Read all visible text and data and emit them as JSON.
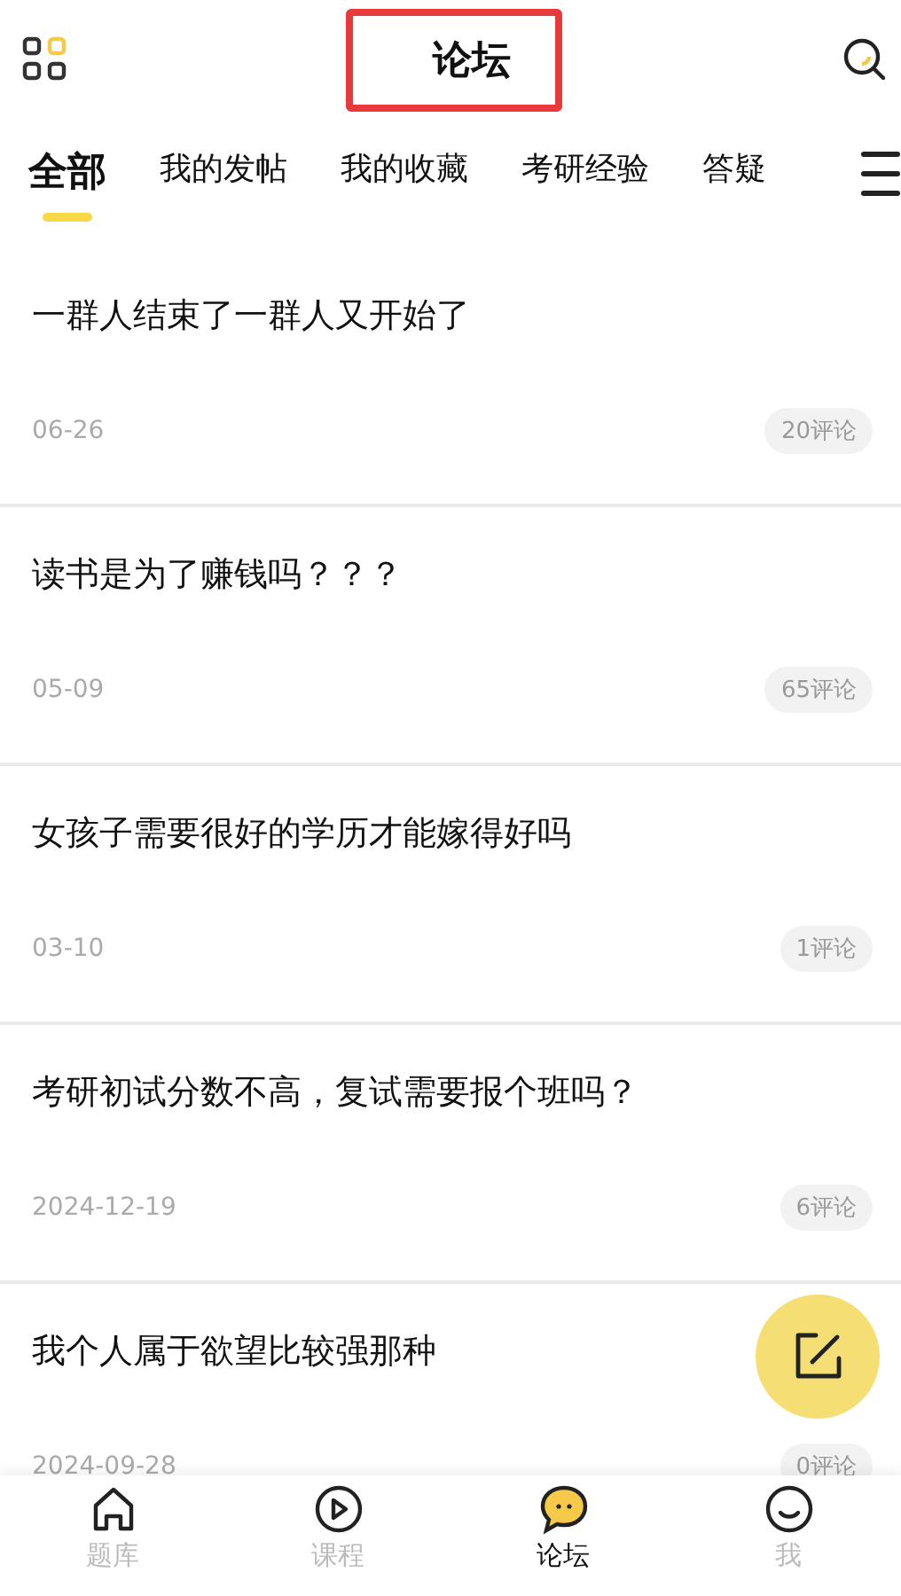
{
  "header": {
    "title": "论坛",
    "title_highlighted": true
  },
  "tabs": [
    {
      "label": "全部",
      "selected": true
    },
    {
      "label": "我的发帖",
      "selected": false
    },
    {
      "label": "我的收藏",
      "selected": false
    },
    {
      "label": "考研经验",
      "selected": false
    },
    {
      "label": "答疑",
      "selected": false
    }
  ],
  "posts": [
    {
      "title": "一群人结束了一群人又开始了",
      "date": "06-26",
      "comments": "20评论"
    },
    {
      "title": "读书是为了赚钱吗？？？",
      "date": "05-09",
      "comments": "65评论"
    },
    {
      "title": "女孩子需要很好的学历才能嫁得好吗",
      "date": "03-10",
      "comments": "1评论"
    },
    {
      "title": "考研初试分数不高，复试需要报个班吗？",
      "date": "2024-12-19",
      "comments": "6评论"
    },
    {
      "title": "我个人属于欲望比较强那种",
      "date": "2024-09-28",
      "comments": "0评论"
    }
  ],
  "bottom_nav": [
    {
      "label": "题库",
      "kind": "home",
      "selected": false
    },
    {
      "label": "课程",
      "kind": "play",
      "selected": false
    },
    {
      "label": "论坛",
      "kind": "chat",
      "selected": true
    },
    {
      "label": "我",
      "kind": "smile",
      "selected": false
    }
  ]
}
